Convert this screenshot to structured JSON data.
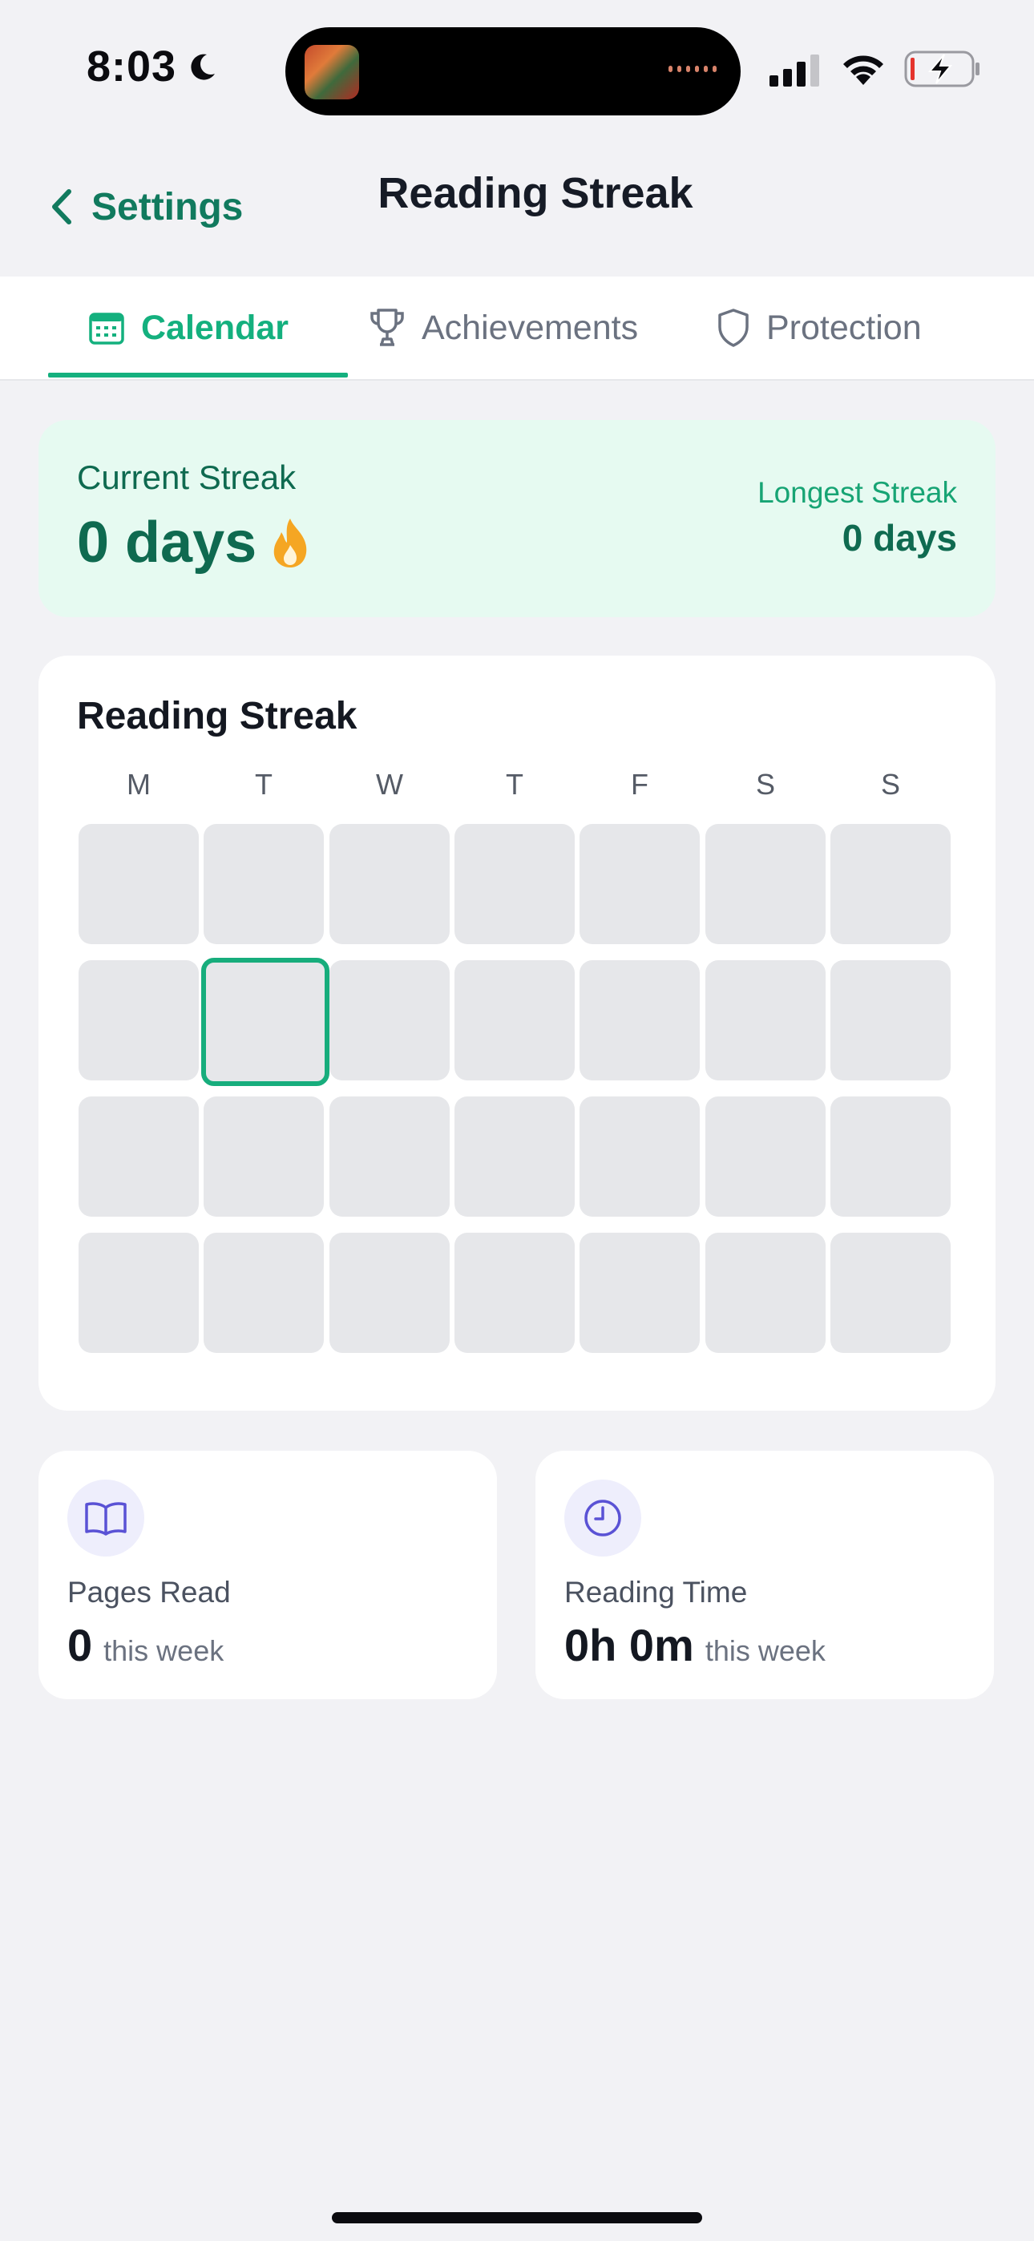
{
  "status": {
    "time": "8:03"
  },
  "nav": {
    "back_label": "Settings",
    "title": "Reading Streak"
  },
  "tabs": [
    {
      "label": "Calendar",
      "icon": "calendar-icon",
      "active": true
    },
    {
      "label": "Achievements",
      "icon": "trophy-icon",
      "active": false
    },
    {
      "label": "Protection",
      "icon": "shield-icon",
      "active": false
    }
  ],
  "streak": {
    "current_label": "Current Streak",
    "current_value": "0 days",
    "longest_label": "Longest Streak",
    "longest_value": "0 days"
  },
  "calendar": {
    "title": "Reading Streak",
    "weekdays": [
      "M",
      "T",
      "W",
      "T",
      "F",
      "S",
      "S"
    ],
    "weeks": 4,
    "today": {
      "week": 2,
      "day": 2
    }
  },
  "stats": [
    {
      "label": "Pages Read",
      "value": "0",
      "unit": "this week",
      "icon": "book-icon"
    },
    {
      "label": "Reading Time",
      "value": "0h 0m",
      "unit": "this week",
      "icon": "clock-icon"
    }
  ],
  "colors": {
    "accent": "#14b07e",
    "accent_dark": "#0f6a50",
    "streak_bg": "#e6faf1",
    "cell": "#e6e7ea",
    "icon_tint": "#5a52d5"
  }
}
